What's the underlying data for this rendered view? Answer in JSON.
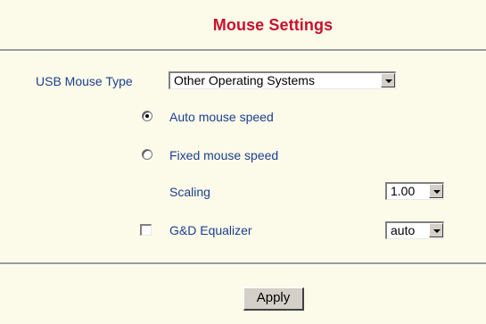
{
  "header": {
    "title": "Mouse Settings"
  },
  "usb_mouse_type": {
    "label": "USB Mouse Type",
    "selected": "Other Operating Systems"
  },
  "mouse_speed": {
    "options": [
      {
        "label": "Auto mouse speed",
        "checked": true
      },
      {
        "label": "Fixed mouse speed",
        "checked": false
      }
    ]
  },
  "scaling": {
    "label": "Scaling",
    "selected": "1.00"
  },
  "equalizer": {
    "label": "G&D Equalizer",
    "checked": false,
    "selected": "auto"
  },
  "footer": {
    "apply_label": "Apply"
  }
}
